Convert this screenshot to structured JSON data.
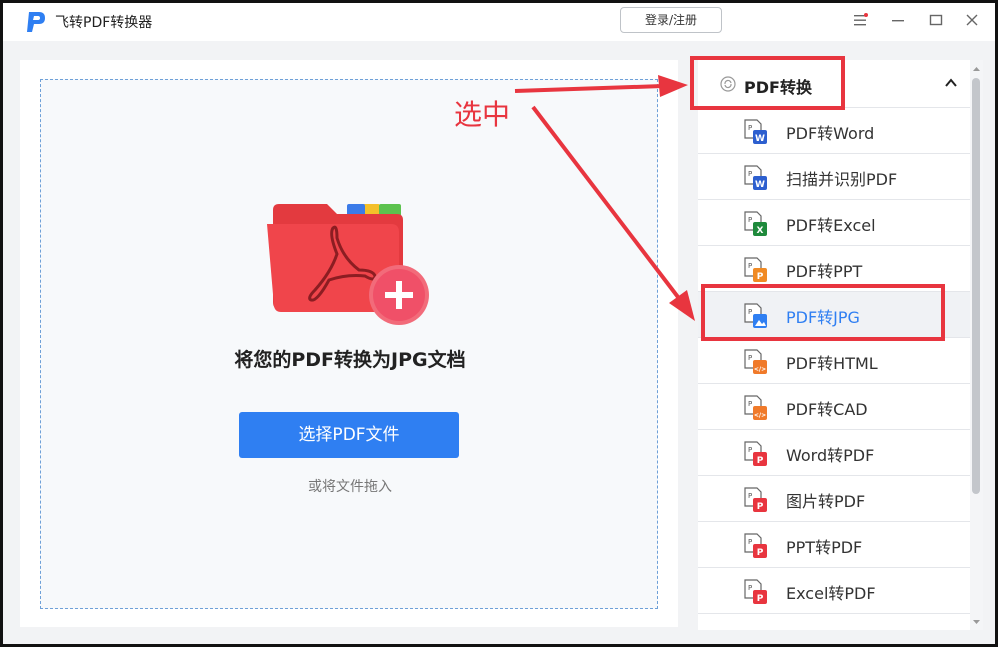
{
  "app": {
    "title": "飞转PDF转换器",
    "login_label": "登录/注册"
  },
  "drop_area": {
    "title": "将您的PDF转换为JPG文档",
    "select_button": "选择PDF文件",
    "drag_hint": "或将文件拖入"
  },
  "sidebar": {
    "category": "PDF转换",
    "items": [
      {
        "label": "PDF转Word",
        "icon": "pdf-to-word-icon",
        "badge": "W",
        "color": "#2d5fcf"
      },
      {
        "label": "扫描并识别PDF",
        "icon": "scan-ocr-pdf-icon",
        "badge": "W",
        "color": "#2d5fcf"
      },
      {
        "label": "PDF转Excel",
        "icon": "pdf-to-excel-icon",
        "badge": "X",
        "color": "#1f8a3c"
      },
      {
        "label": "PDF转PPT",
        "icon": "pdf-to-ppt-icon",
        "badge": "P",
        "color": "#f08a24"
      },
      {
        "label": "PDF转JPG",
        "icon": "pdf-to-jpg-icon",
        "badge": "",
        "color": "#2f7ff2"
      },
      {
        "label": "PDF转HTML",
        "icon": "pdf-to-html-icon",
        "badge": "</>",
        "color": "#f07a2a"
      },
      {
        "label": "PDF转CAD",
        "icon": "pdf-to-cad-icon",
        "badge": "</>",
        "color": "#f07a2a"
      },
      {
        "label": "Word转PDF",
        "icon": "word-to-pdf-icon",
        "badge": "P",
        "color": "#e8353f"
      },
      {
        "label": "图片转PDF",
        "icon": "image-to-pdf-icon",
        "badge": "P",
        "color": "#e8353f"
      },
      {
        "label": "PPT转PDF",
        "icon": "ppt-to-pdf-icon",
        "badge": "P",
        "color": "#e8353f"
      },
      {
        "label": "Excel转PDF",
        "icon": "excel-to-pdf-icon",
        "badge": "P",
        "color": "#e8353f"
      }
    ]
  },
  "annotation": {
    "label": "选中",
    "color": "#e8353f"
  },
  "colors": {
    "accent": "#2f7ff2",
    "annotation": "#e8353f",
    "folder": "#e8353f"
  }
}
